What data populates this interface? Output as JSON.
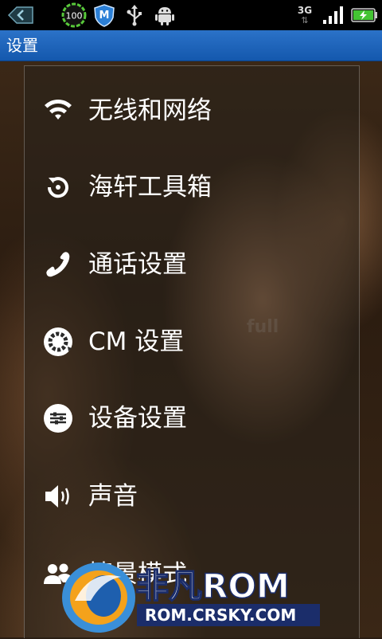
{
  "status_bar": {
    "battery_badge": "100",
    "network_type": "3G",
    "icons": [
      "back-arrow-icon",
      "battery-100-icon",
      "security-shield-icon",
      "usb-icon",
      "android-icon",
      "signal-icon",
      "battery-charging-icon"
    ]
  },
  "title_bar": {
    "title": "设置"
  },
  "menu": {
    "items": [
      {
        "label": "无线和网络",
        "icon": "wifi-icon"
      },
      {
        "label": "海轩工具箱",
        "icon": "refresh-icon"
      },
      {
        "label": "通话设置",
        "icon": "phone-icon"
      },
      {
        "label": "CM 设置",
        "icon": "cm-gear-icon"
      },
      {
        "label": "设备设置",
        "icon": "device-settings-icon"
      },
      {
        "label": "声音",
        "icon": "speaker-icon"
      },
      {
        "label": "情景模式",
        "icon": "people-icon"
      }
    ]
  },
  "background": {
    "ghost_word": "full"
  },
  "watermark": {
    "brand": "非凡ROM",
    "url": "ROM.CRSKY.COM"
  },
  "colors": {
    "title_bar": "#1a5fb4",
    "status_bar": "#000000",
    "battery_green": "#43c433"
  }
}
